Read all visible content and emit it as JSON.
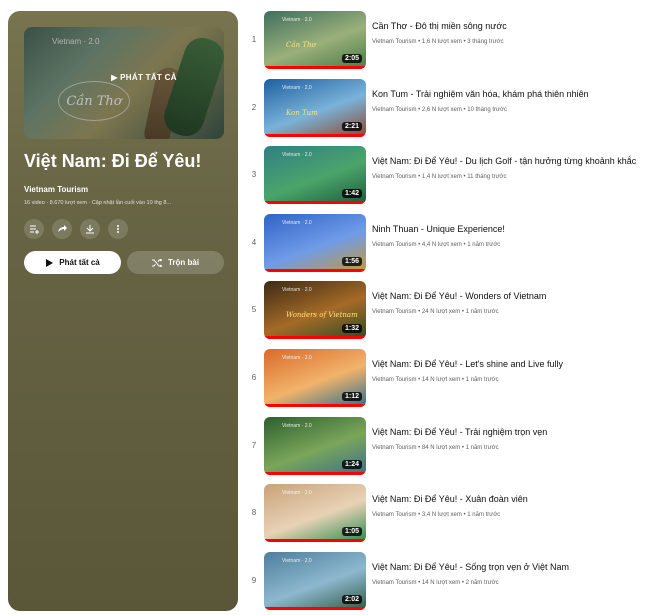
{
  "playlist": {
    "thumbnail_logo": "Cần Thơ",
    "thumbnail_brand": "Vietnam · 2.0",
    "play_all_overlay": "▶ PHÁT TẤT CẢ",
    "title": "Việt Nam: Đi Để Yêu!",
    "channel": "Vietnam Tourism",
    "meta": "16 video · 8.670 lượt xem · Cập nhật lần cuối vào 10 thg 8...",
    "icons": [
      "add-to-queue-icon",
      "share-icon",
      "download-icon",
      "more-icon"
    ],
    "play_all_label": "Phát tất cả",
    "shuffle_label": "Trộn bài"
  },
  "videos": [
    {
      "index": "1",
      "title": "Cần Thơ - Đô thị miền sông nước",
      "meta": "Vietnam Tourism • 1,6 N lượt xem • 3 tháng trước",
      "duration": "2:05",
      "tag": "Cần Thơ",
      "colors": [
        "#3f6e5e",
        "#9ab07a",
        "#4a7a45"
      ]
    },
    {
      "index": "2",
      "title": "Kon Tum - Trải nghiệm văn hóa, khám phá thiên nhiên",
      "meta": "Vietnam Tourism • 2,6 N lượt xem • 10 tháng trước",
      "duration": "2:21",
      "tag": "Kon Tum",
      "colors": [
        "#1d5fa0",
        "#7ab2d9",
        "#8a4a2c"
      ]
    },
    {
      "index": "3",
      "title": "Việt Nam: Đi Để Yêu! - Du lịch Golf - tận hưởng từng khoảnh khắc",
      "meta": "Vietnam Tourism • 1,4 N lượt xem • 11 tháng trước",
      "duration": "1:42",
      "tag": "",
      "colors": [
        "#2f7f84",
        "#4aa56a",
        "#1f5a3c"
      ]
    },
    {
      "index": "4",
      "title": "Ninh Thuan - Unique Experience!",
      "meta": "Vietnam Tourism • 4,4 N lượt xem • 1 năm trước",
      "duration": "1:56",
      "tag": "",
      "colors": [
        "#2f63c6",
        "#6f9be8",
        "#c49a3a"
      ]
    },
    {
      "index": "5",
      "title": "Việt Nam: Đi Để Yêu! - Wonders of Vietnam",
      "meta": "Vietnam Tourism • 24 N lượt xem • 1 năm trước",
      "duration": "1:32",
      "tag": "Wonders of Vietnam",
      "colors": [
        "#3b2a16",
        "#a56a26",
        "#2e4a26"
      ]
    },
    {
      "index": "6",
      "title": "Việt Nam: Đi Để Yêu! - Let's shine and Live fully",
      "meta": "Vietnam Tourism • 14 N lượt xem • 1 năm trước",
      "duration": "1:12",
      "tag": "",
      "colors": [
        "#d96a2a",
        "#f2b36a",
        "#2f6f8f"
      ]
    },
    {
      "index": "7",
      "title": "Việt Nam: Đi Để Yêu! - Trải nghiệm trọn vẹn",
      "meta": "Vietnam Tourism • 84 N lượt xem • 1 năm trước",
      "duration": "1:24",
      "tag": "",
      "colors": [
        "#2d5f2f",
        "#7aa65a",
        "#3a6e8a"
      ]
    },
    {
      "index": "8",
      "title": "Việt Nam: Đi Để Yêu! - Xuân đoàn viên",
      "meta": "Vietnam Tourism • 3,4 N lượt xem • 1 năm trước",
      "duration": "1:05",
      "tag": "",
      "colors": [
        "#c9a27a",
        "#e8d2b6",
        "#2c8a4e"
      ]
    },
    {
      "index": "9",
      "title": "Việt Nam: Đi Để Yêu! - Sống trọn vẹn ở Việt Nam",
      "meta": "Vietnam Tourism • 14 N lượt xem • 2 năm trước",
      "duration": "2:02",
      "tag": "",
      "colors": [
        "#4d7e9c",
        "#8db8cf",
        "#2f5a46"
      ]
    }
  ]
}
